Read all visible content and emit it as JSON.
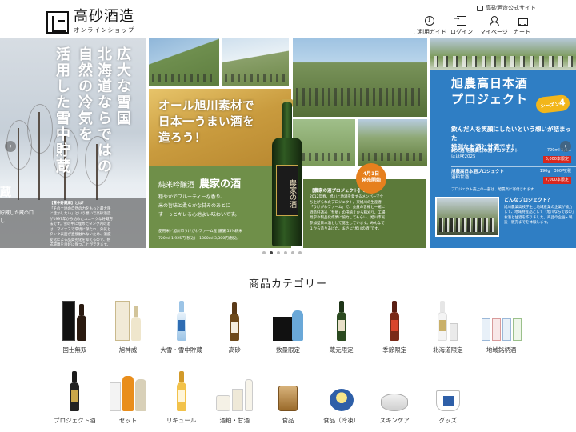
{
  "header": {
    "logo_title": "高砂酒造",
    "logo_sub": "オンラインショップ",
    "official_link": "高砂酒造公式サイト",
    "nav": [
      {
        "label": "ご利用ガイド",
        "icon": "info-icon"
      },
      {
        "label": "ログイン",
        "icon": "login-icon"
      },
      {
        "label": "マイページ",
        "icon": "user-icon"
      },
      {
        "label": "カート",
        "icon": "cart-icon"
      }
    ]
  },
  "banner": {
    "left": {
      "vertical_lines": [
        "広大な雪国",
        "北海道ならではの",
        "自然の冷気を",
        "活用した雪中貯蔵"
      ],
      "kura": "蔵",
      "side_text_1": "貯蔵した蔵の口",
      "side_text_2": "し",
      "info_head": "【雪中貯蔵庫】とは？",
      "info_body": "「その土地の自然の力をもっと最大限に活かしたい」という想いで高砂酒造が1997年から始めたユニークな貯蔵方法です。雪の中に埋めたタンク内の酒は、マイナスで環境に保たれ、外気とタンク表面が直接触れないため、温度変化による品質劣化を抑えるので、熟成環境を良好に保つことができます。"
    },
    "main": {
      "rice_title_1": "オール旭川素材で",
      "rice_title_2": "日本一うまい酒を",
      "rice_title_3": "造ろう！",
      "product_type": "純米吟醸酒",
      "product_name": "農家の酒",
      "bottle_label": "農家の酒",
      "desc_1": "穏やかでフルーティーな香り、",
      "desc_2": "米の旨味と柔らかな甘みのあとに",
      "desc_3": "すーっとキレる心地よい味わいです。",
      "spec_1": "使用米／旭川市うけがわファーム産 醸醸 55%精米",
      "spec_2": "720ml 1,925円(税込)　1800ml 3,300円(税込)",
      "release_1": "4月1日",
      "release_2": "発売開始",
      "project_head": "【農家の酒プロジェクト】とは？",
      "project_body": "2012年春、旭川と地酒を愛するメンバーで立ち上げられたプロジェクト。東旭川の生産者「うけがわファーム」で、会員の皆様と一緒に酒造好適米「彗星」の田植えから稲刈り、工場見学や製品化作業に協力してもらい、旭川市民参加型日本酒として誕生しています。みんなで１から造りあげた、まさに“旭川の酒”です。"
    },
    "right": {
      "title_1": "旭農高日本酒",
      "title_2": "プロジェクト",
      "season_label": "シーズン",
      "season_num": "4",
      "catch_1": "飲んだ人を笑顔にしたいという想いが詰まった",
      "catch_2": "特別なお酒と甘酒です！",
      "products": [
        {
          "name": "純米酒 旭農高日本酒プロジェクト",
          "sub": "ほほ咲2025",
          "price": "720ml 1,4...",
          "tag": "6,000本限定"
        },
        {
          "name": "旭農高日本酒プロジェクト",
          "sub": "酒粕甘酒",
          "price": "190g　300円(税",
          "tag": "7,000本限定"
        }
      ],
      "note": "プロジェクト売上の一部は、旭農高に寄付されます",
      "how_head": "どんなプロジェクト？",
      "how_body": "旭川農業高校学生と地域産業の企業が協力して、地域特産品として「旭川ならではの」お酒と甘酒を作りました。商品の企画・製造・販売までを体験します。"
    },
    "arrows": {
      "prev": "‹",
      "next": "›"
    },
    "dots": [
      false,
      true,
      false,
      false,
      false,
      false
    ]
  },
  "categories": {
    "heading": "商品カテゴリー",
    "items": [
      "国士無双",
      "旭神威",
      "大雪・雪中貯蔵",
      "高砂",
      "数量限定",
      "蔵元限定",
      "季節限定",
      "北海道限定",
      "地域銘柄酒",
      "プロジェクト酒",
      "セット",
      "リキュール",
      "酒粕・甘酒",
      "食品",
      "食品（冷凍）",
      "スキンケア",
      "グッズ"
    ]
  },
  "colors": {
    "green_panel": "#6f8f49",
    "blue_panel": "#2f7ec4",
    "release_badge": "#e6801e",
    "season_badge": "#f2b61a",
    "limited_tag": "#d8271f"
  }
}
